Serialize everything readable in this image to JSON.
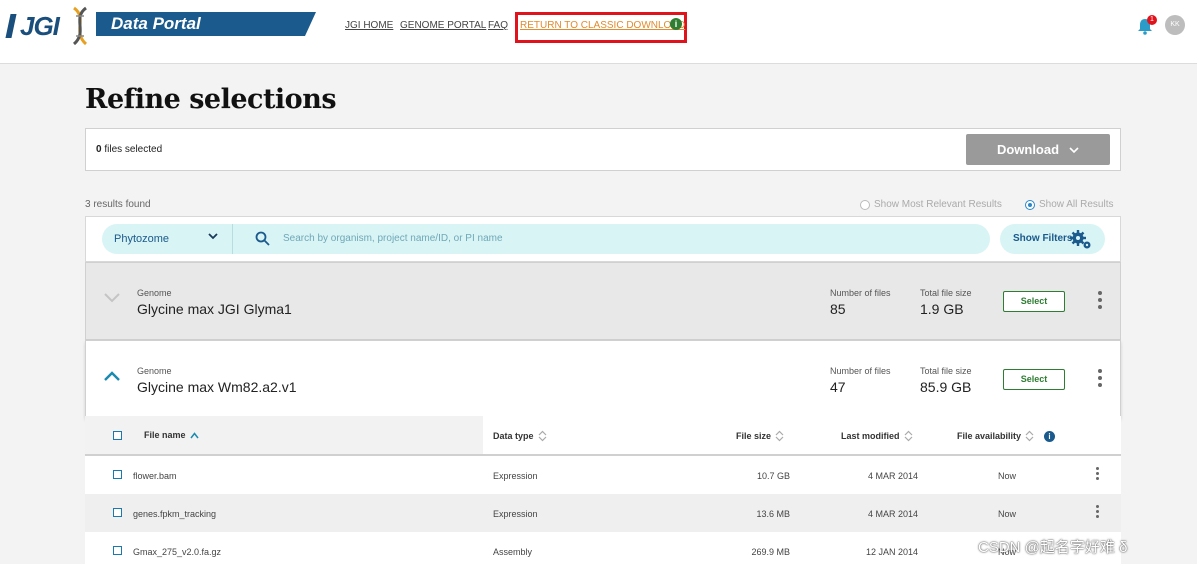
{
  "header": {
    "logo_text": "JGI",
    "portal_title": "Data Portal",
    "nav": [
      "JGI HOME",
      "GENOME PORTAL",
      "FAQ"
    ],
    "classic_link": "RETURN TO CLASSIC DOWNLOAD",
    "notification_count": "1",
    "avatar_initials": "KK"
  },
  "page_title": "Refine selections",
  "selection": {
    "count": "0",
    "suffix": " files selected",
    "download_label": "Download"
  },
  "results": {
    "summary": "3 results found",
    "radio_relevant": "Show Most Relevant Results",
    "radio_all": "Show All Results"
  },
  "filterbar": {
    "portal_select": "Phytozome",
    "search_placeholder": "Search by organism, project name/ID, or PI name",
    "filters_label": "Show Filters"
  },
  "genomes": [
    {
      "type_label": "Genome",
      "name": "Glycine max JGI Glyma1",
      "num_files_label": "Number of files",
      "num_files": "85",
      "size_label": "Total file size",
      "size": "1.9 GB",
      "select_label": "Select",
      "expanded": false
    },
    {
      "type_label": "Genome",
      "name": "Glycine max Wm82.a2.v1",
      "num_files_label": "Number of files",
      "num_files": "47",
      "size_label": "Total file size",
      "size": "85.9 GB",
      "select_label": "Select",
      "expanded": true
    }
  ],
  "table": {
    "columns": [
      "File name",
      "Data type",
      "File size",
      "Last modified",
      "File availability"
    ],
    "rows": [
      {
        "name": "flower.bam",
        "type": "Expression",
        "size": "10.7 GB",
        "modified": "4 MAR 2014",
        "availability": "Now"
      },
      {
        "name": "genes.fpkm_tracking",
        "type": "Expression",
        "size": "13.6 MB",
        "modified": "4 MAR 2014",
        "availability": "Now"
      },
      {
        "name": "Gmax_275_v2.0.fa.gz",
        "type": "Assembly",
        "size": "269.9 MB",
        "modified": "12 JAN 2014",
        "availability": "Now"
      }
    ]
  },
  "watermark": "CSDN @起名字好难 δ"
}
